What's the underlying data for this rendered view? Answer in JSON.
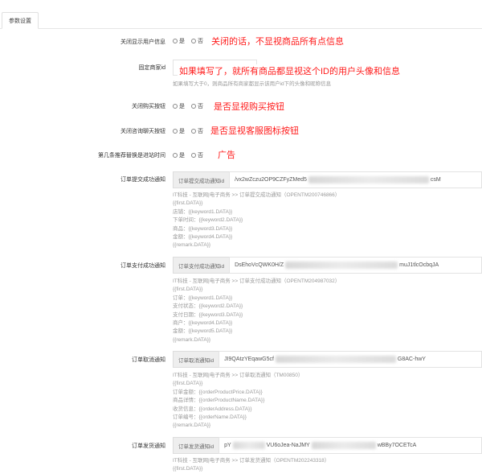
{
  "tabs": [
    {
      "label": "参数设置"
    }
  ],
  "settings": {
    "hide_shop_info": {
      "label": "关闭显示用户信息",
      "options": [
        "是",
        "否"
      ],
      "note": "关闭的话，不显视商品所有点信息"
    },
    "fixed_user_id": {
      "label": "固定商家id",
      "value": "",
      "help": "如果填写大于0，则商品所有商家都显示该用户id下的头像和昵称信息",
      "note": "如果填写了，就所有商品都显视这个ID的用户头像和信息"
    },
    "close_buy_button": {
      "label": "关闭购买按钮",
      "options": [
        "是",
        "否"
      ],
      "note": "是否显视购买按钮"
    },
    "close_service_button": {
      "label": "关闭咨询聊天按钮",
      "options": [
        "是",
        "否"
      ],
      "note": "是否显视客服图标按钮"
    },
    "show_ads": {
      "label": "第几条推荐替换是进站时间",
      "options": [
        "是",
        "否"
      ],
      "note": "广告"
    }
  },
  "templates": [
    {
      "label": "订单提交成功通知",
      "addon": "订单提交成功通知id",
      "value_start": "/vx2wZczu2OP9CZFyZMed5",
      "value_end": "csM",
      "lines": [
        "IT科技 - 互联网|电子商务 >> 订单提交成功通知（OPENTM200746866）",
        "{{first.DATA}}",
        "店铺：{{keyword1.DATA}}",
        "下单时间：{{keyword2.DATA}}",
        "商品：{{keyword3.DATA}}",
        "金额：{{keyword4.DATA}}",
        "{{remark.DATA}}"
      ]
    },
    {
      "label": "订单支付成功通知",
      "addon": "订单支付成功通知id",
      "value_start": "DsEhoVcQWK0H/Z",
      "value_end": "muJ1tlcOcbqJA",
      "lines": [
        "IT科技 - 互联网|电子商务 >> 订单支付成功通知（OPENTM204987032）",
        "{{first.DATA}}",
        "订单：{{keyword1.DATA}}",
        "支付状态：{{keyword2.DATA}}",
        "支付日期：{{keyword3.DATA}}",
        "商户：{{keyword4.DATA}}",
        "金额：{{keyword5.DATA}}",
        "{{remark.DATA}}"
      ]
    },
    {
      "label": "订单取消通知",
      "addon": "订单取消通知id",
      "value_start": "JI9QAtzYEqawG5cf",
      "value_end": "G8AC-hwY",
      "lines": [
        "IT科技 - 互联网|电子商务 >> 订单取消通知（TM00850）",
        "{{first.DATA}}",
        "订单金额：{{orderProductPrice.DATA}}",
        "商品详情：{{orderProductName.DATA}}",
        "收货信息：{{orderAddress.DATA}}",
        "订单编号：{{orderName.DATA}}",
        "{{remark.DATA}}"
      ]
    },
    {
      "label": "订单发货通知",
      "addon": "订单发货通知id",
      "value_start": "pY",
      "value_mid": "VU6oJea-NaJMY",
      "value_end": "wBBy7OCETcA",
      "lines": [
        "IT科技 - 互联网|电子商务 >> 订单发货通知（OPENTM202243318）",
        "{{first.DATA}}"
      ]
    }
  ]
}
